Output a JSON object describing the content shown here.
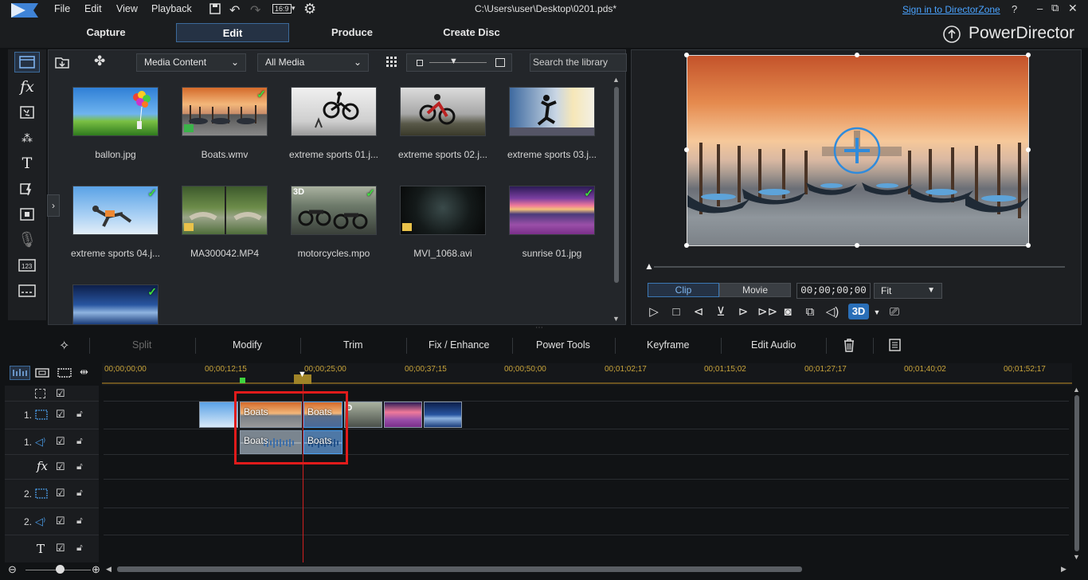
{
  "menu": {
    "items": [
      "File",
      "Edit",
      "View",
      "Playback"
    ],
    "aspect": "16:9"
  },
  "window": {
    "title": "C:\\Users\\user\\Desktop\\0201.pds*",
    "signin": "Sign in to DirectorZone"
  },
  "modes": {
    "tabs": [
      "Capture",
      "Edit",
      "Produce",
      "Create Disc"
    ],
    "active": "Edit"
  },
  "brand": "PowerDirector",
  "library": {
    "content_dropdown": "Media Content",
    "filter_dropdown": "All Media",
    "search_placeholder": "Search the library",
    "items": [
      {
        "label": "ballon.jpg",
        "checked": false,
        "badge": ""
      },
      {
        "label": "Boats.wmv",
        "checked": true,
        "badge": "video"
      },
      {
        "label": "extreme sports 01.j...",
        "checked": false,
        "badge": ""
      },
      {
        "label": "extreme sports 02.j...",
        "checked": false,
        "badge": ""
      },
      {
        "label": "extreme sports 03.j...",
        "checked": false,
        "badge": ""
      },
      {
        "label": "extreme sports 04.j...",
        "checked": true,
        "badge": ""
      },
      {
        "label": "MA300042.MP4",
        "checked": false,
        "badge": "video"
      },
      {
        "label": "motorcycles.mpo",
        "checked": true,
        "badge": "3D"
      },
      {
        "label": "MVI_1068.avi",
        "checked": false,
        "badge": "video"
      },
      {
        "label": "sunrise 01.jpg",
        "checked": true,
        "badge": ""
      },
      {
        "label": "",
        "checked": true,
        "badge": ""
      }
    ]
  },
  "preview": {
    "clip_tab": "Clip",
    "movie_tab": "Movie",
    "timecode": "00;00;00;00",
    "zoom": "Fit",
    "threed": "3D"
  },
  "toolbar": {
    "split": "Split",
    "modify": "Modify",
    "trim": "Trim",
    "fix": "Fix / Enhance",
    "power": "Power Tools",
    "keyframe": "Keyframe",
    "audio": "Edit Audio"
  },
  "timeline": {
    "ruler": [
      "00;00;00;00",
      "00;00;12;15",
      "00;00;25;00",
      "00;00;37;15",
      "00;00;50;00",
      "00;01;02;17",
      "00;01;15;02",
      "00;01;27;17",
      "00;01;40;02",
      "00;01;52;17"
    ],
    "tracks": [
      {
        "num": "",
        "kind": "master"
      },
      {
        "num": "1.",
        "kind": "video"
      },
      {
        "num": "1.",
        "kind": "audio"
      },
      {
        "num": "",
        "kind": "fx"
      },
      {
        "num": "2.",
        "kind": "video"
      },
      {
        "num": "2.",
        "kind": "audio"
      },
      {
        "num": "",
        "kind": "title"
      }
    ],
    "clip_label_1": "Boats",
    "clip_label_2": "Boats",
    "audio_label_1": "Boats",
    "audio_label_2": "Boats"
  }
}
